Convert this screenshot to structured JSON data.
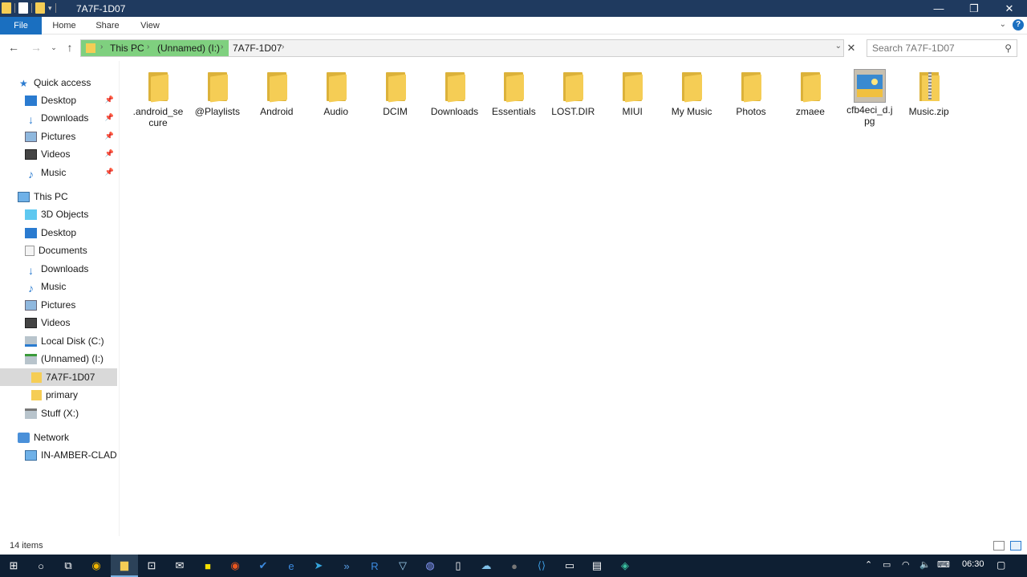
{
  "window": {
    "title": "7A7F-1D07"
  },
  "ribbon": {
    "tabs": [
      "File",
      "Home",
      "Share",
      "View"
    ]
  },
  "address": {
    "crumbs": [
      "This PC",
      "(Unnamed) (I:)",
      "7A7F-1D07"
    ]
  },
  "search": {
    "placeholder": "Search 7A7F-1D07"
  },
  "sidebar": {
    "quick_access": "Quick access",
    "quick_items": [
      "Desktop",
      "Downloads",
      "Pictures",
      "Videos",
      "Music"
    ],
    "this_pc": "This PC",
    "pc_items": [
      "3D Objects",
      "Desktop",
      "Documents",
      "Downloads",
      "Music",
      "Pictures",
      "Videos",
      "Local Disk (C:)",
      "(Unnamed) (I:)"
    ],
    "drive_children": [
      "7A7F-1D07",
      "primary"
    ],
    "stuff": "Stuff (X:)",
    "network": "Network",
    "network_items": [
      "IN-AMBER-CLAD"
    ]
  },
  "files": [
    {
      "name": ".android_secure",
      "line1": ".android_se",
      "line2": "cure",
      "kind": "folder"
    },
    {
      "name": "@Playlists",
      "line1": "@Playlists",
      "line2": "",
      "kind": "folder"
    },
    {
      "name": "Android",
      "line1": "Android",
      "line2": "",
      "kind": "folder"
    },
    {
      "name": "Audio",
      "line1": "Audio",
      "line2": "",
      "kind": "folder"
    },
    {
      "name": "DCIM",
      "line1": "DCIM",
      "line2": "",
      "kind": "folder"
    },
    {
      "name": "Downloads",
      "line1": "Downloads",
      "line2": "",
      "kind": "folder"
    },
    {
      "name": "Essentials",
      "line1": "Essentials",
      "line2": "",
      "kind": "folder"
    },
    {
      "name": "LOST.DIR",
      "line1": "LOST.DIR",
      "line2": "",
      "kind": "folder"
    },
    {
      "name": "MIUI",
      "line1": "MIUI",
      "line2": "",
      "kind": "folder"
    },
    {
      "name": "My Music",
      "line1": "My Music",
      "line2": "",
      "kind": "folder"
    },
    {
      "name": "Photos",
      "line1": "Photos",
      "line2": "",
      "kind": "folder"
    },
    {
      "name": "zmaee",
      "line1": "zmaee",
      "line2": "",
      "kind": "folder"
    },
    {
      "name": "cfb4eci_d.jpg",
      "line1": "cfb4eci_d.j",
      "line2": "pg",
      "kind": "image"
    },
    {
      "name": "Music.zip",
      "line1": "Music.zip",
      "line2": "",
      "kind": "zip"
    }
  ],
  "status": {
    "count": "14 items"
  },
  "clock": {
    "time": "06:30"
  },
  "colors": {
    "titlebar": "#1f3a5f",
    "file_tab": "#1a6fc0",
    "address_highlight": "#7fd07f",
    "folder": "#f5cd55",
    "taskbar": "#0e1f33"
  }
}
